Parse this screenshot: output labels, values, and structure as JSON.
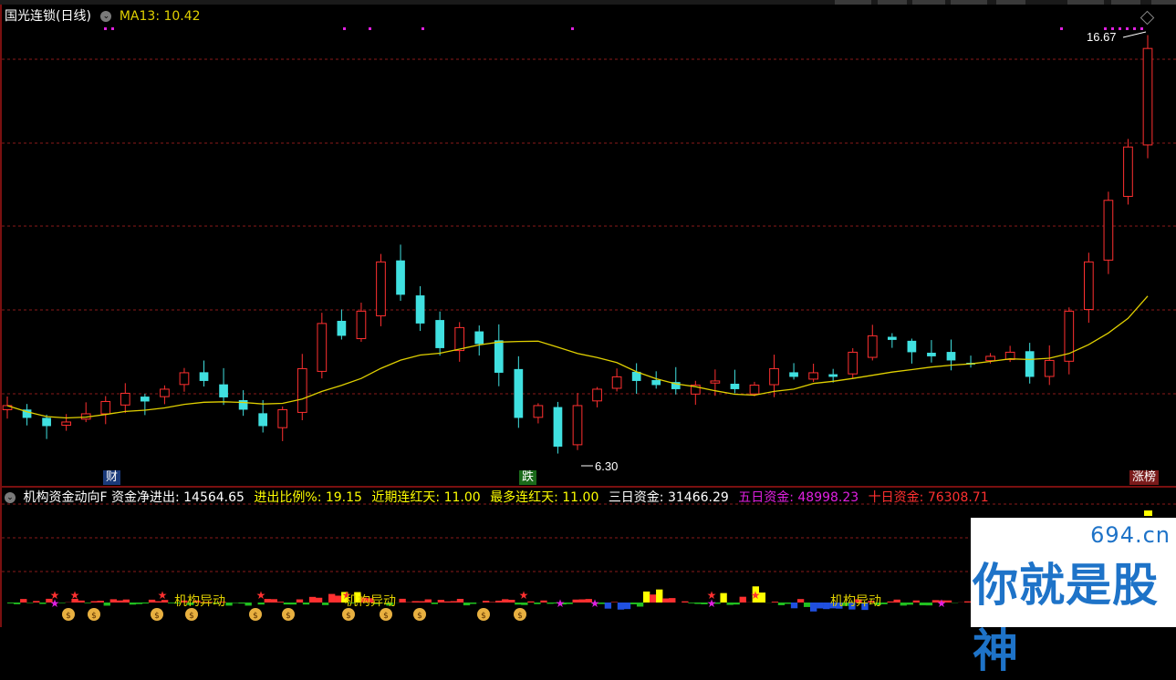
{
  "main_panel": {
    "stock_title": "国光连锁(日线)",
    "ma_label": "MA13: 10.42",
    "max_label": "16.67",
    "min_label": "6.30",
    "badge_cai": "财",
    "badge_die": "跌",
    "badge_zhangbang": "涨榜"
  },
  "sub_panel": {
    "indicator_name": "机构资金动向F",
    "net_flow": "资金净进出: 14564.65",
    "ratio": "进出比例%: 19.15",
    "recent_red": "近期连红天: 11.00",
    "max_red": "最多连红天: 11.00",
    "three_day": "三日资金: 31466.29",
    "five_day": "五日资金: 48998.23",
    "ten_day": "十日资金: 76308.71",
    "anomaly_label": "机构异动"
  },
  "watermark": {
    "domain": "694.cn",
    "slogan": "你就是股神"
  },
  "colors": {
    "up": "#ff3030",
    "down": "#40e0e0",
    "ma": "#e0d000",
    "grid": "#8a1a1a",
    "magenta": "#e020e0",
    "yellow": "#ffff00",
    "brand": "#1e73c8"
  },
  "chart_data": {
    "type": "candlestick",
    "ma_period": 13,
    "ma_last": 10.42,
    "high": 16.67,
    "low": 6.3,
    "closes": [
      7.5,
      7.2,
      7.0,
      7.1,
      7.3,
      7.6,
      7.8,
      7.6,
      7.9,
      8.3,
      8.1,
      7.7,
      7.4,
      7.0,
      7.4,
      8.4,
      9.5,
      9.2,
      9.8,
      11.0,
      10.2,
      9.5,
      8.9,
      9.4,
      9.0,
      8.3,
      7.2,
      7.5,
      6.5,
      7.5,
      7.9,
      8.2,
      8.1,
      8.0,
      7.9,
      8.0,
      8.1,
      7.9,
      8.0,
      8.4,
      8.2,
      8.3,
      8.2,
      8.8,
      9.2,
      9.1,
      8.8,
      8.7,
      8.6,
      8.5,
      8.7,
      8.8,
      8.2,
      8.6,
      9.8,
      11.0,
      12.5,
      13.8,
      16.2
    ],
    "fund_flow_last": 14564.65
  }
}
